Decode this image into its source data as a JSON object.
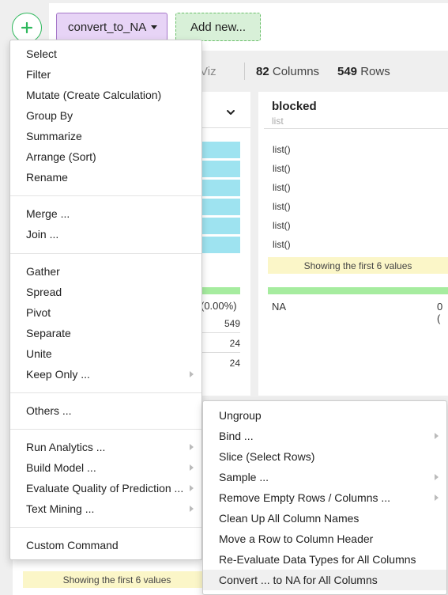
{
  "toolbar": {
    "step_label": "convert_to_NA",
    "add_new_label": "Add new..."
  },
  "summary": {
    "viz_tab": "Viz",
    "columns_count": "82",
    "columns_label": "Columns",
    "rows_count": "549",
    "rows_label": "Rows"
  },
  "left_column": {
    "na_pct": "(0.00%)",
    "rows": [
      "549",
      "24",
      "24"
    ]
  },
  "right_column": {
    "name": "blocked",
    "type": "list",
    "values": [
      "list()",
      "list()",
      "list()",
      "list()",
      "list()",
      "list()"
    ],
    "showing_note": "Showing the first 6 values",
    "na_label": "NA",
    "na_count": "0 ("
  },
  "bottom_card": {
    "showing_note": "Showing the first 6 values"
  },
  "menu": {
    "group1": [
      "Select",
      "Filter",
      "Mutate (Create Calculation)",
      "Group By",
      "Summarize",
      "Arrange (Sort)",
      "Rename"
    ],
    "group2": [
      "Merge ...",
      "Join ..."
    ],
    "group3": [
      "Gather",
      "Spread",
      "Pivot",
      "Separate",
      "Unite",
      "Keep Only ..."
    ],
    "group4": [
      "Others ..."
    ],
    "group5": [
      "Run Analytics ...",
      "Build Model ...",
      "Evaluate Quality of Prediction ...",
      "Text Mining ..."
    ],
    "group6": [
      "Custom Command"
    ]
  },
  "submenu": {
    "items": [
      "Ungroup",
      "Bind ...",
      "Slice (Select Rows)",
      "Sample ...",
      "Remove Empty Rows / Columns ...",
      "Clean Up All Column Names",
      "Move a Row to Column Header",
      "Re-Evaluate Data Types for All Columns",
      "Convert ... to NA for All Columns"
    ],
    "highlighted": "Convert ... to NA for All Columns"
  },
  "colors": {
    "accent_green": "#2eb85c",
    "step_chip_bg": "#e7d4f6",
    "add_new_bg": "#d8f0d8",
    "histogram": "#9ee3f0",
    "na_bar": "#a6ec9f",
    "note_bg": "#fbf6c8"
  }
}
